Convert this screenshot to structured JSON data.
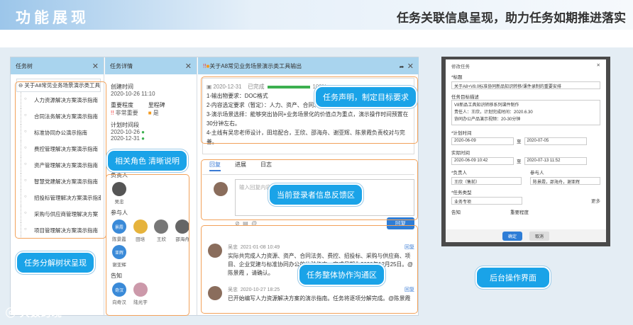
{
  "header": {
    "title": "功能展现",
    "subtitle": "任务关联信息呈现，助力任务如期推进落实"
  },
  "tree": {
    "title": "任务树",
    "root": "关于A8常见业务场景演示类工具输",
    "items": [
      "人力资源解决方案演示指南",
      "合同法务解决方案演示指南",
      "标准协同办公演示指南",
      "费控管理解决方案演示指南",
      "资产管理解决方案演示指南",
      "智慧党建解决方案演示指南",
      "招投标管理解决方案演示指南",
      "采购与供应商管理解决方案",
      "项目管理解决方案演示指南"
    ]
  },
  "detail": {
    "title": "任务详情",
    "created_label": "创建时间",
    "created": "2020-10-26 11:10",
    "importance_label": "重要程度",
    "importance": "非常重要",
    "milestone_label": "里程碑",
    "milestone": "是",
    "plan_label": "计划时间段",
    "plan_start": "2020-10-26",
    "plan_end": "2020-12-31",
    "owner_label": "负责人",
    "owner": "吴忠",
    "participants_label": "参与人",
    "participants": [
      "陈景霞",
      "田培",
      "王欣",
      "邵海舟",
      "谢亚辉"
    ],
    "p_badges": [
      "景霞",
      "亚辉"
    ],
    "notify_label": "告知",
    "notify": [
      "向奇汉",
      "陆光宇"
    ],
    "notify_badge": "奇汉"
  },
  "task": {
    "title": "关于A8常见业务场景演示类工具输出",
    "date": "2020-12-31",
    "status": "已完成",
    "progress": "100%",
    "lines": [
      "1-输出物要求：DOC格式",
      "2-内容选定要求（暂定）：人力、资产、合同、费控、采购（招标）、标准协同办公",
      "3-演示场景选择：能够突出协同+业务场景化的价值点为重点，演示操作时间预置在30分钟左右。",
      "4-主线有吴忠老师设计，田培配合，王欣、邵海舟、谢亚辉、陈景霞负责校对与完善。"
    ]
  },
  "tabs": [
    "回复",
    "进展",
    "日志"
  ],
  "reply": {
    "placeholder": "输入回复内容，可@人（不超过500字）",
    "button": "回复"
  },
  "comments": [
    {
      "name": "吴忠",
      "time": "2021-01-08 10:49",
      "text": "实际共完成人力资源、资产、合同法务、费控、招投标、采购与供应商、项目、企业党建与标准协同办公的体验指南，完成日期为2020年12月25日。@陈景霞 ，请确认。",
      "reply": "回复"
    },
    {
      "name": "吴忠",
      "time": "2020-10-27 18:25",
      "text": "已开始编写人力资源解决方案的演示指南。任务将逐项分解完成。@陈景霞",
      "reply": "回复"
    }
  ],
  "callouts": {
    "statement": "任务声明，制定目标要求",
    "roles": "相关角色 清晰说明",
    "feedback": "当前登录者信息反馈区",
    "collab": "任务整体协作沟通区",
    "tree": "任务分解树状呈现",
    "admin": "后台操作界面"
  },
  "admin": {
    "title": "修改任务",
    "f_title": "*标题",
    "title_val": "关于A8+V8.0标准协同新品知识转移/课件录制的重要安排",
    "goal_label": "任务目标描述",
    "goal_lines": [
      "V8新品工具知识转移系列课件制作",
      "责任人：王欣，计划完成时间：2020.6.30",
      "协同办公产品演示视频：20-30分钟"
    ],
    "plan_label": "*计划时间",
    "plan_start": "2020-06-09",
    "plan_end": "2020-07-05",
    "to": "至",
    "actual_label": "实际时间",
    "actual_start": "2020-06-09 10:42",
    "actual_end": "2020-07-13 11:52",
    "owner_label": "*负责人",
    "owner": "王欣（售前）",
    "part_label": "参与人",
    "part": "陈景霞，邵海舟，谢亚辉",
    "type_label": "*任务类型",
    "type": "业务专项",
    "more": "更多",
    "notify_label": "告知",
    "imp_label": "重要程度",
    "ok": "确定",
    "cancel": "取消"
  },
  "logo": "大数跨境"
}
